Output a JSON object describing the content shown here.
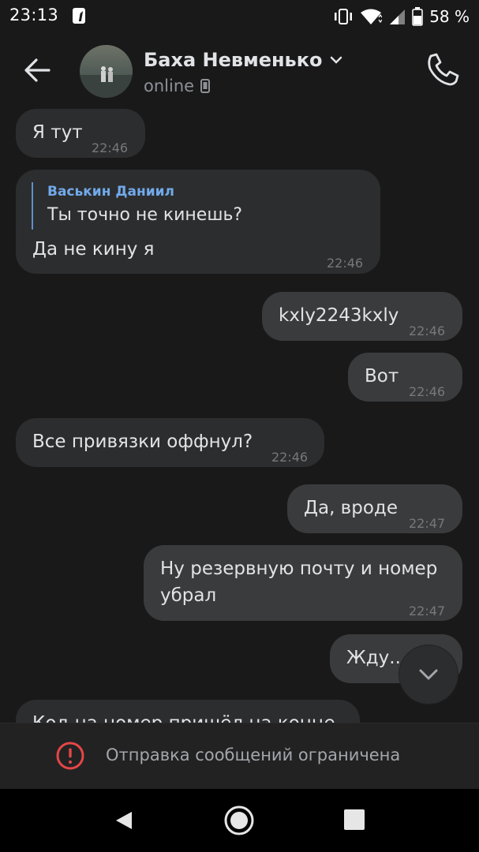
{
  "status_bar": {
    "time": "23:13",
    "battery": "58 %"
  },
  "header": {
    "name": "Баха Невменько",
    "status": "online"
  },
  "messages": [
    {
      "direction": "in",
      "text": "Я тут",
      "time": "22:46"
    },
    {
      "direction": "in",
      "reply_author": "Васькин Даниил",
      "reply_text": "Ты точно не кинешь?",
      "text": "Да не кину я",
      "time": "22:46"
    },
    {
      "direction": "out",
      "text": "kxly2243kxly",
      "time": "22:46"
    },
    {
      "direction": "out",
      "text": "Вот",
      "time": "22:46"
    },
    {
      "direction": "in",
      "text": "Все привязки оффнул?",
      "time": "22:46"
    },
    {
      "direction": "out",
      "text": "Да, вроде",
      "time": "22:47"
    },
    {
      "direction": "out",
      "text": "Ну резервную почту и номер убрал",
      "time": "22:47"
    },
    {
      "direction": "out",
      "text": "Жду..",
      "time": ""
    },
    {
      "direction": "in",
      "text": "Код на номер пришёл на конце",
      "time": ""
    }
  ],
  "restriction": {
    "text": "Отправка сообщений ограничена"
  },
  "colors": {
    "background": "#19191a",
    "bubble_in": "#2c2d2e",
    "bubble_out": "#3a3b3c",
    "reply_accent": "#71aaeb",
    "alert_red": "#e64646"
  },
  "icons": [
    "back-arrow-icon",
    "chevron-down-icon",
    "phone-icon",
    "mobile-device-icon",
    "chevron-down-icon",
    "alert-circle-icon",
    "nav-back-icon",
    "nav-home-icon",
    "nav-recents-icon"
  ]
}
